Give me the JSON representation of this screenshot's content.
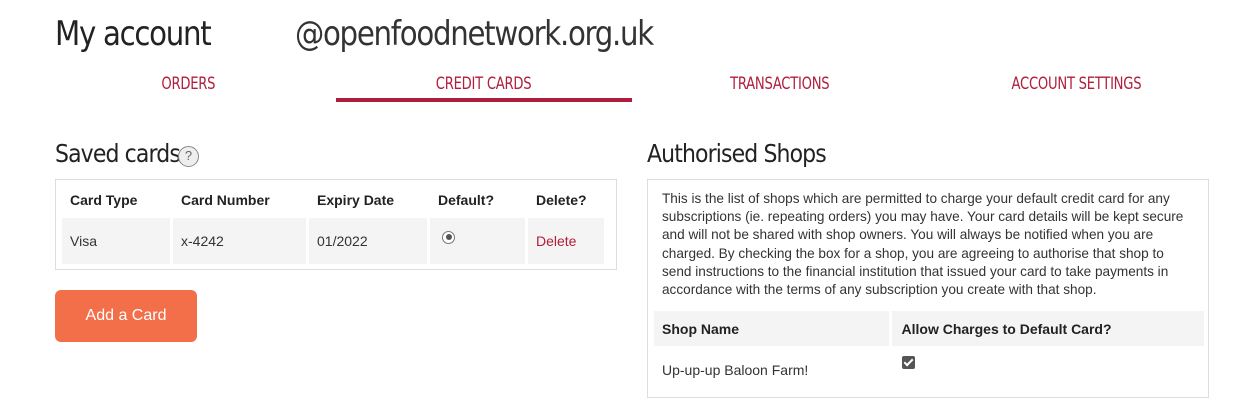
{
  "header": {
    "title": "My account",
    "email": "@openfoodnetwork.org.uk"
  },
  "tabs": [
    {
      "label": "ORDERS",
      "active": false
    },
    {
      "label": "CREDIT CARDS",
      "active": true
    },
    {
      "label": "TRANSACTIONS",
      "active": false
    },
    {
      "label": "ACCOUNT SETTINGS",
      "active": false
    }
  ],
  "saved_cards": {
    "title": "Saved cards",
    "help_icon": "?",
    "columns": [
      "Card Type",
      "Card Number",
      "Expiry Date",
      "Default?",
      "Delete?"
    ],
    "rows": [
      {
        "card_type": "Visa",
        "card_number": "x-4242",
        "expiry_date": "01/2022",
        "default": true,
        "delete_label": "Delete"
      }
    ],
    "add_button": "Add a Card"
  },
  "authorised_shops": {
    "title": "Authorised Shops",
    "description": "This is the list of shops which are permitted to charge your default credit card for any subscriptions (ie. repeating orders) you may have. Your card details will be kept secure and will not be shared with shop owners. You will always be notified when you are charged. By checking the box for a shop, you are agreeing to authorise that shop to send instructions to the financial institution that issued your card to take payments in accordance with the terms of any subscription you create with that shop.",
    "columns": [
      "Shop Name",
      "Allow Charges to Default Card?"
    ],
    "rows": [
      {
        "shop_name": "Up-up-up Baloon Farm!",
        "allow_charges": true
      }
    ]
  },
  "colors": {
    "accent": "#b01e3c",
    "button": "#f26f4a"
  }
}
